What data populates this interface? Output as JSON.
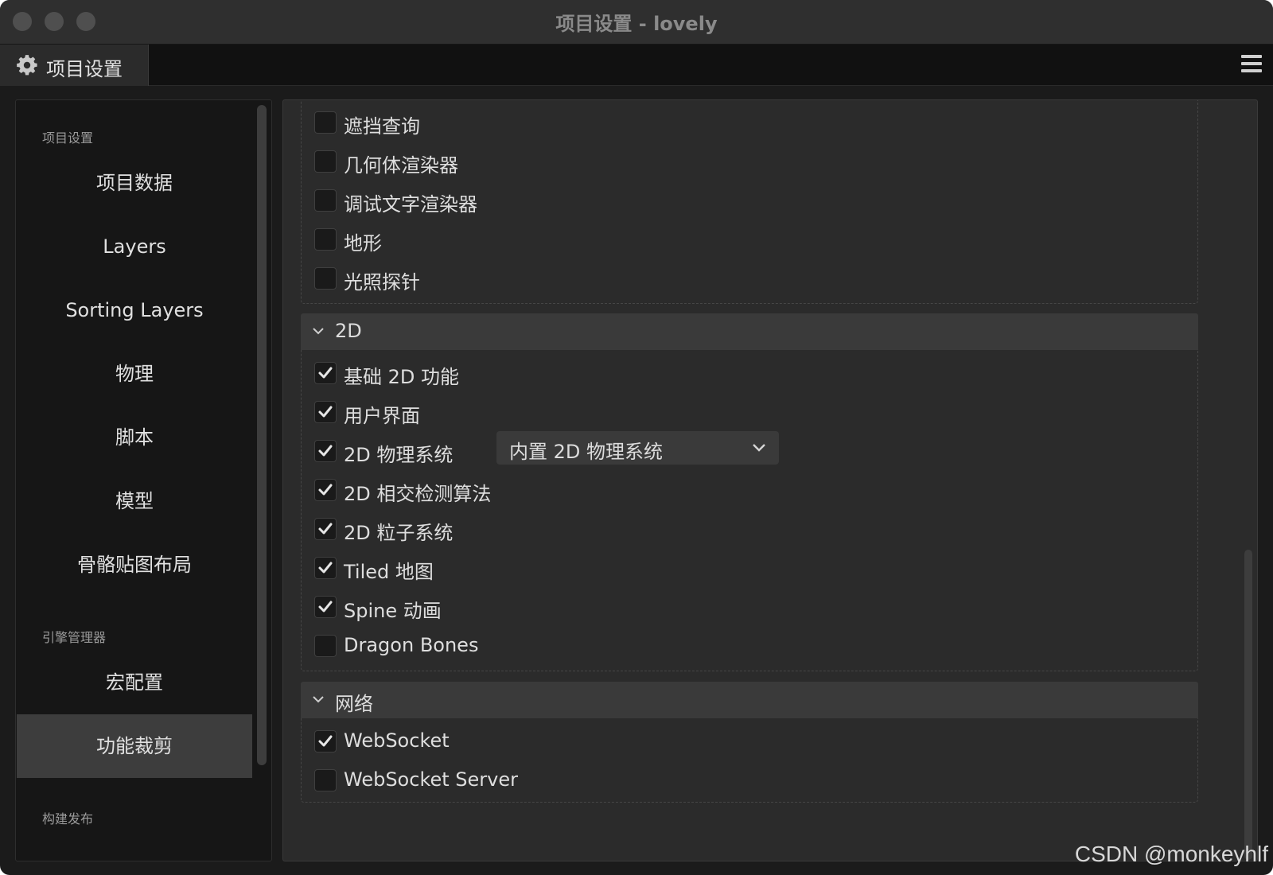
{
  "window": {
    "title": "项目设置 - lovely"
  },
  "tab": {
    "label": "项目设置",
    "icon": "gear-icon"
  },
  "sidebar": {
    "sections": [
      {
        "title": "项目设置",
        "items": [
          "项目数据",
          "Layers",
          "Sorting Layers",
          "物理",
          "脚本",
          "模型",
          "骨骼贴图布局"
        ]
      },
      {
        "title": "引擎管理器",
        "items": [
          "宏配置",
          "功能裁剪"
        ]
      },
      {
        "title": "构建发布",
        "items": []
      }
    ],
    "active_item": "功能裁剪"
  },
  "main": {
    "top_options": [
      {
        "label": "遮挡查询",
        "checked": false
      },
      {
        "label": "几何体渲染器",
        "checked": false
      },
      {
        "label": "调试文字渲染器",
        "checked": false
      },
      {
        "label": "地形",
        "checked": false
      },
      {
        "label": "光照探针",
        "checked": false
      }
    ],
    "section_2d": {
      "title": "2D",
      "options": [
        {
          "label": "基础 2D 功能",
          "checked": true
        },
        {
          "label": "用户界面",
          "checked": true
        },
        {
          "label": "2D 物理系统",
          "checked": true
        },
        {
          "label": "2D 相交检测算法",
          "checked": true
        },
        {
          "label": "2D 粒子系统",
          "checked": true
        },
        {
          "label": "Tiled 地图",
          "checked": true
        },
        {
          "label": "Spine 动画",
          "checked": true
        },
        {
          "label": "Dragon Bones",
          "checked": false
        }
      ],
      "physics_select": {
        "value": "内置 2D 物理系统"
      }
    },
    "section_network": {
      "title": "网络",
      "options": [
        {
          "label": "WebSocket",
          "checked": true
        },
        {
          "label": "WebSocket Server",
          "checked": false
        }
      ]
    }
  },
  "watermark": "CSDN @monkeyhlf"
}
